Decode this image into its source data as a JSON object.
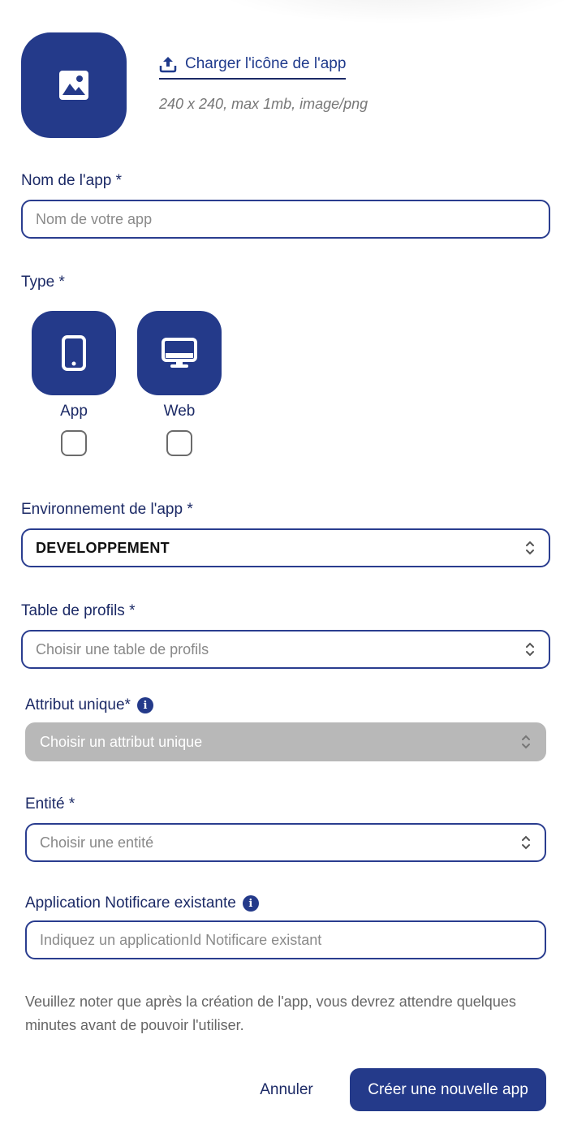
{
  "icon_upload": {
    "link_label": "Charger l'icône de l'app",
    "hint": "240 x 240, max 1mb, image/png",
    "placeholder_icon": "image-icon",
    "upload_icon": "upload-icon"
  },
  "app_name": {
    "label": "Nom de l'app *",
    "placeholder": "Nom de votre app",
    "value": ""
  },
  "type": {
    "label": "Type *",
    "options": [
      {
        "label": "App",
        "icon": "mobile-icon",
        "checked": false
      },
      {
        "label": "Web",
        "icon": "desktop-icon",
        "checked": false
      }
    ]
  },
  "environment": {
    "label": "Environnement de l'app *",
    "value": "DEVELOPPEMENT"
  },
  "profile_table": {
    "label": "Table de profils *",
    "placeholder": "Choisir une table de profils"
  },
  "unique_attribute": {
    "label": "Attribut unique*",
    "placeholder": "Choisir un attribut unique",
    "disabled": true
  },
  "entity": {
    "label": "Entité *",
    "placeholder": "Choisir une entité"
  },
  "notificare": {
    "label": "Application Notificare existante",
    "placeholder": "Indiquez un applicationId Notificare existant"
  },
  "note": "Veuillez noter que après la création de l'app, vous devrez attendre quelques minutes avant de pouvoir l'utiliser.",
  "actions": {
    "cancel": "Annuler",
    "submit": "Créer une nouvelle app"
  },
  "colors": {
    "primary": "#243a8a",
    "text": "#1c2a66",
    "disabled": "#b8b8b8"
  }
}
